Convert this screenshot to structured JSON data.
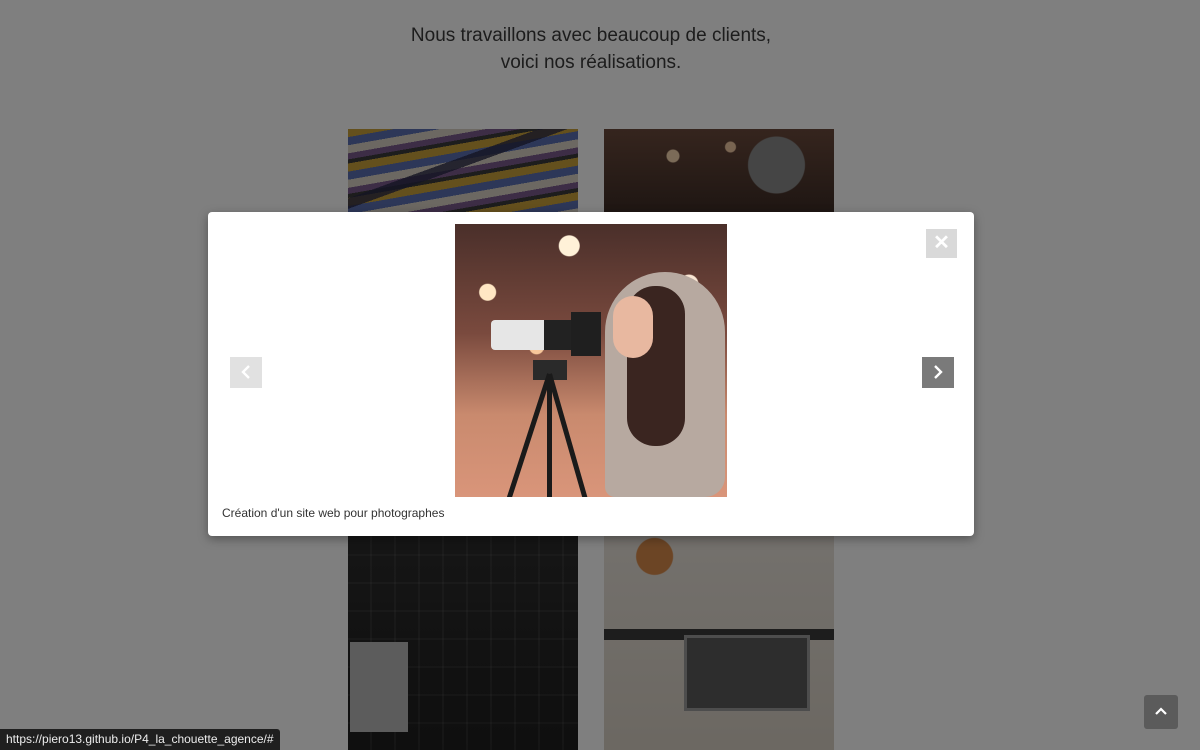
{
  "intro": {
    "line1": "Nous travaillons avec beaucoup de clients,",
    "line2": "voici nos réalisations."
  },
  "modal": {
    "caption": "Création d'un site web pour photographes",
    "close_symbol": "✕",
    "prev_icon": "chevron-left-icon",
    "next_icon": "chevron-right-icon"
  },
  "scroll_top": {
    "icon": "chevron-up-icon"
  },
  "status_bar": {
    "url": "https://piero13.github.io/P4_la_chouette_agence/#"
  },
  "colors": {
    "overlay": "#808080",
    "modal_bg": "#ffffff",
    "close_bg": "#d9d9d9",
    "nav_next_bg": "#7a7a7a",
    "nav_prev_bg": "#e1e1e1",
    "scroll_top_bg": "#5b5b5b"
  }
}
